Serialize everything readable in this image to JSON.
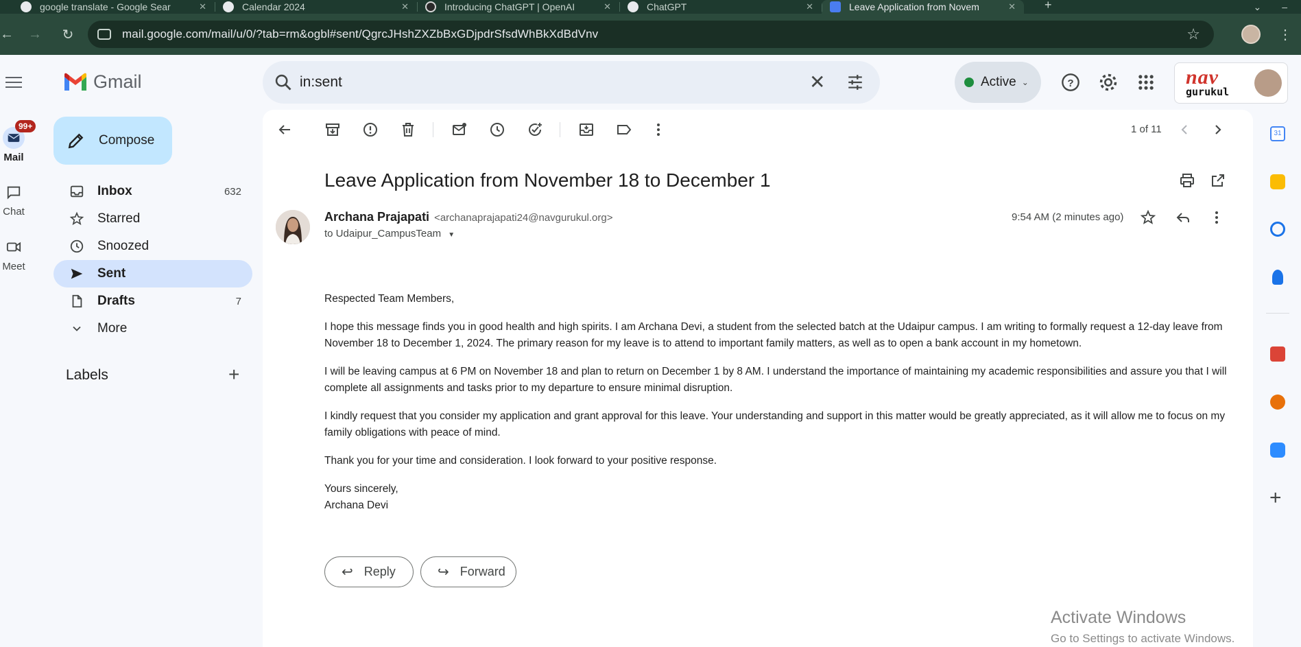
{
  "browser": {
    "tabs": [
      {
        "title": "google translate - Google Sear",
        "active": false
      },
      {
        "title": "Calendar 2024",
        "active": false
      },
      {
        "title": "Introducing ChatGPT | OpenAI",
        "active": false
      },
      {
        "title": "ChatGPT",
        "active": false
      },
      {
        "title": "Leave Application from Novem",
        "active": true
      }
    ],
    "url": "mail.google.com/mail/u/0/?tab=rm&ogbl#sent/QgrcJHshZXZbBxGDjpdrSfsdWhBkXdBdVnv"
  },
  "header": {
    "app_name": "Gmail",
    "search_value": "in:sent",
    "status_label": "Active",
    "org_logo_line1": "nav",
    "org_logo_line2": "gurukul"
  },
  "rail": {
    "mail_label": "Mail",
    "mail_badge": "99+",
    "chat_label": "Chat",
    "meet_label": "Meet"
  },
  "sidebar": {
    "compose_label": "Compose",
    "items": [
      {
        "label": "Inbox",
        "count": "632"
      },
      {
        "label": "Starred",
        "count": ""
      },
      {
        "label": "Snoozed",
        "count": ""
      },
      {
        "label": "Sent",
        "count": ""
      },
      {
        "label": "Drafts",
        "count": "7"
      },
      {
        "label": "More",
        "count": ""
      }
    ],
    "labels_heading": "Labels"
  },
  "toolbar": {
    "pager": "1 of 11"
  },
  "message": {
    "subject": "Leave Application from November 18 to December 1",
    "sender_name": "Archana Prajapati",
    "sender_email": "<archanaprajapati24@navgurukul.org>",
    "to_line": "to Udaipur_CampusTeam",
    "time": "9:54 AM (2 minutes ago)",
    "greeting": "Respected Team Members,",
    "paragraphs": [
      "I hope this message finds you in good health and high spirits. I am Archana Devi, a student from the selected batch at the Udaipur campus. I am writing to formally request a 12-day leave from November 18 to December 1, 2024. The primary reason for my leave is to attend to important family matters, as well as to open a bank account in my hometown.",
      "I will be leaving campus at 6 PM on November 18 and plan to return on December 1 by 8 AM. I understand the importance of maintaining my academic responsibilities and assure you that I will complete all assignments and tasks prior to my departure to ensure minimal disruption.",
      "I kindly request that you consider my application and grant approval for this leave. Your understanding and support in this matter would be greatly appreciated, as it will allow me to focus on my family obligations with peace of mind.",
      "Thank you for your time and consideration. I look forward to your positive response."
    ],
    "closing": "Yours sincerely,",
    "signature": "Archana Devi",
    "reply_label": "Reply",
    "forward_label": "Forward"
  },
  "watermark": {
    "line1": "Activate Windows",
    "line2": "Go to Settings to activate Windows."
  },
  "colors": {
    "browser_frame": "#2b4a3c",
    "compose_bg": "#c2e7ff",
    "selected_nav": "#d3e3fd",
    "active_dot": "#1e8e3e",
    "badge": "#b3261e"
  }
}
